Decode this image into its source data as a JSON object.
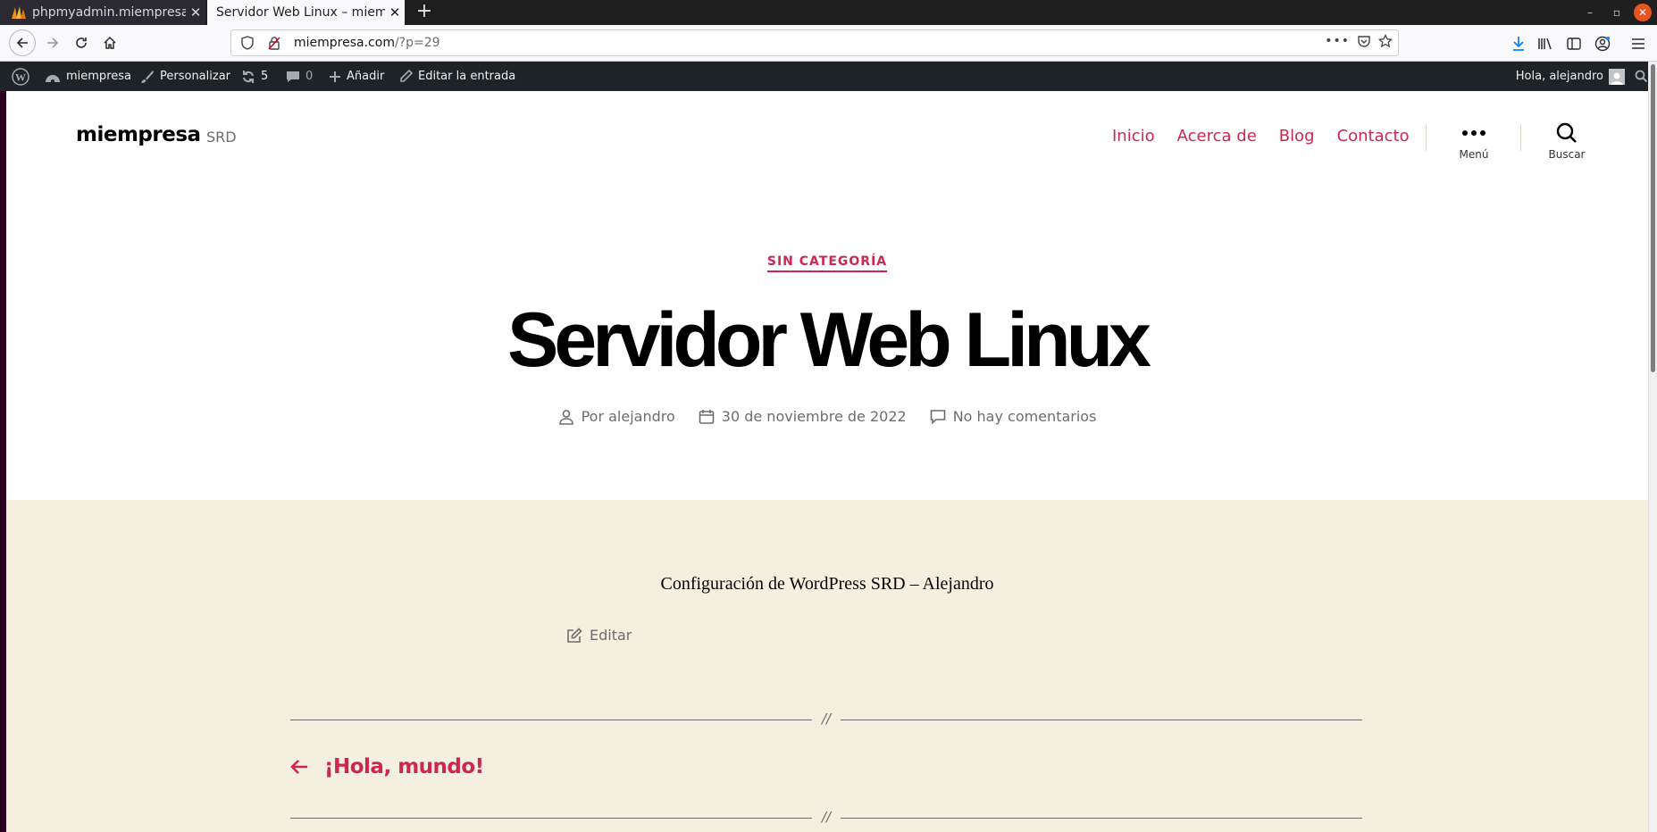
{
  "browser": {
    "tabs": [
      {
        "title": "phpmyadmin.miempresa",
        "active": false
      },
      {
        "title": "Servidor Web Linux – miempresa",
        "active": true
      }
    ],
    "url": {
      "host": "miempresa.com",
      "path": "/?p=29"
    }
  },
  "adminbar": {
    "site_name": "miempresa",
    "customize": "Personalizar",
    "updates_count": "5",
    "comments_count": "0",
    "add_new": "Añadir",
    "edit_post": "Editar la entrada",
    "greeting": "Hola, alejandro"
  },
  "header": {
    "site_title": "miempresa",
    "site_description": "SRD",
    "nav": [
      "Inicio",
      "Acerca de",
      "Blog",
      "Contacto"
    ],
    "menu_label": "Menú",
    "search_label": "Buscar"
  },
  "post": {
    "category": "SIN CATEGORÍA",
    "title": "Servidor Web Linux",
    "author": "Por alejandro",
    "date": "30 de noviembre de 2022",
    "comments": "No hay comentarios",
    "content": "Configuración de WordPress SRD – Alejandro",
    "edit_label": "Editar",
    "divider_symbol": "//",
    "prev_post": "¡Hola, mundo!"
  },
  "colors": {
    "accent": "#cd2653",
    "background": "#f5efe0",
    "adminbar": "#1d2327"
  }
}
